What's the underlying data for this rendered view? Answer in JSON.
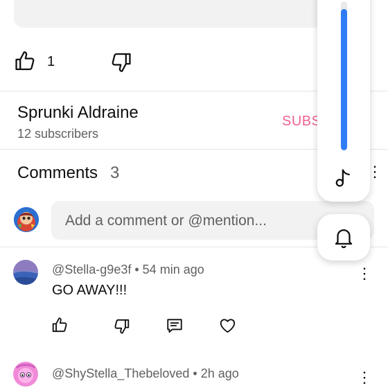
{
  "video_actions": {
    "like_count": "1"
  },
  "channel": {
    "name": "Sprunki Aldraine",
    "subscribers": "12 subscribers",
    "subscribe_label": "SUBS"
  },
  "comments": {
    "title": "Comments",
    "count": "3",
    "input_placeholder": "Add a comment or @mention...",
    "items": [
      {
        "handle": "@Stella-g9e3f",
        "time": "54 min ago",
        "text": "GO AWAY!!!"
      },
      {
        "handle": "@ShyStella_Thebeloved",
        "time": "2h ago",
        "text": ""
      }
    ]
  },
  "volume_panel": {
    "level": 0.95,
    "icons": [
      "music-note-icon",
      "bell-icon"
    ]
  },
  "colors": {
    "accent_blue": "#2f7cf6",
    "subscribe_pink": "#f06292",
    "muted_text": "#606060",
    "input_bg": "#f2f2f2"
  }
}
